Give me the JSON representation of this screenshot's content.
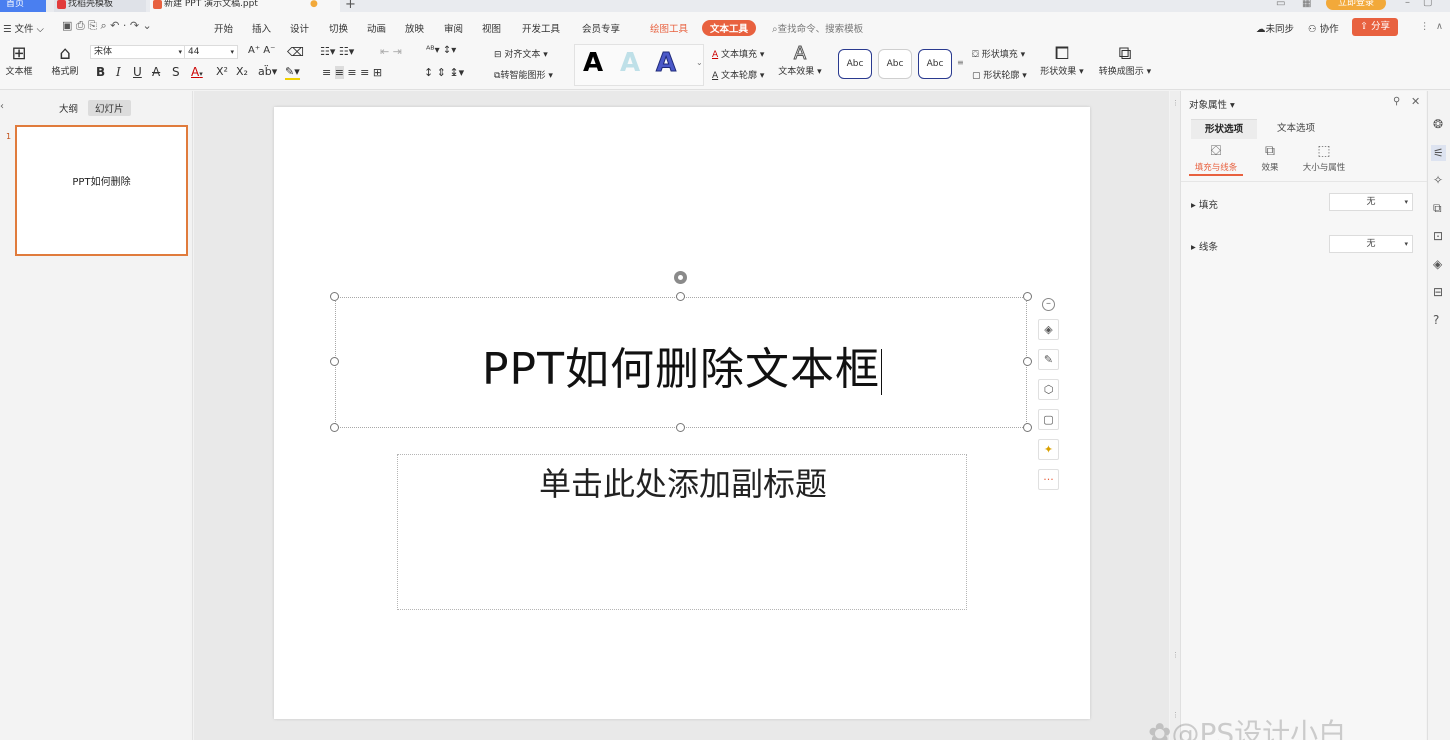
{
  "titlebar": {
    "home": "首页",
    "tab1": "找稻壳模板",
    "tab2": "新建 PPT 演示文稿.ppt",
    "login": "立即登录",
    "add_tab": "+"
  },
  "menubar": {
    "file": "文件",
    "items": [
      "开始",
      "插入",
      "设计",
      "切换",
      "动画",
      "放映",
      "审阅",
      "视图",
      "开发工具",
      "会员专享"
    ],
    "draw_tools": "绘图工具",
    "text_tools": "文本工具",
    "search": "查找命令、搜索模板",
    "sync": "未同步",
    "collab": "协作",
    "share": "分享"
  },
  "toolbar": {
    "textbox": "文本框",
    "format_painter": "格式刷",
    "font_name": "宋体",
    "font_size": "44",
    "bold": "B",
    "italic": "I",
    "underline": "U",
    "strike": "A",
    "shadow": "S",
    "align_text": "对齐文本",
    "smart_shape": "转智能图形",
    "text_fill": "文本填充",
    "text_outline": "文本轮廓",
    "text_effect": "文本效果",
    "abc1": "Abc",
    "abc2": "Abc",
    "abc3": "Abc",
    "shape_fill": "形状填充",
    "shape_outline": "形状轮廓",
    "shape_effect": "形状效果",
    "convert_diagram": "转换成图示"
  },
  "leftpanel": {
    "tab_outline": "大纲",
    "tab_slides": "幻灯片",
    "slide_number": "1",
    "thumb_title": "PPT如何删除"
  },
  "slide": {
    "title": "PPT如何删除文本框",
    "subtitle": "单击此处添加副标题"
  },
  "rightpanel": {
    "title": "对象属性",
    "tab_shape": "形状选项",
    "tab_text": "文本选项",
    "sub_fill_line": "填充与线条",
    "sub_effect": "效果",
    "sub_size": "大小与属性",
    "fill_label": "填充",
    "fill_value": "无",
    "line_label": "线条",
    "line_value": "无"
  },
  "watermark": "@PS设计小白"
}
